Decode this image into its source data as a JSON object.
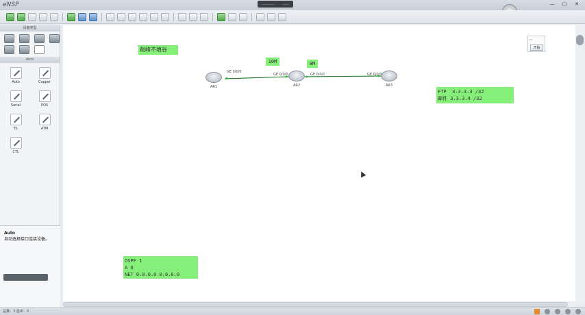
{
  "window": {
    "app_title": "eNSP",
    "title_pill": [
      "…………",
      "……"
    ],
    "buttons": [
      "—",
      "▢",
      "✕"
    ]
  },
  "left_panel": {
    "devices_header": "设备类型",
    "connections_header": "Auto",
    "connections": [
      {
        "label": "Auto"
      },
      {
        "label": "Copper"
      },
      {
        "label": "Serial"
      },
      {
        "label": "POS"
      },
      {
        "label": "E1"
      },
      {
        "label": "ATM"
      },
      {
        "label": "CTL"
      }
    ],
    "description": {
      "title": "Auto",
      "text": "自动选择接口连接设备。"
    }
  },
  "canvas": {
    "notes": {
      "split": "削峰不填谷",
      "bw1": "10M",
      "bw2": "8M",
      "ftp": "FTP  3.3.3.3 /32\n邮件 3.3.3.4 /32",
      "ospf": "OSPF 1\nA 0\nNET 0.0.0.0 0.0.0.0"
    },
    "routers": [
      {
        "name": "AR1"
      },
      {
        "name": "AR2"
      },
      {
        "name": "AR3"
      }
    ],
    "ports": [
      "GE 0/0/0",
      "GE 0/0/0",
      "GE 0/0/1",
      "GE 0/0/0"
    ],
    "start_button": "开始"
  },
  "statusbar": {
    "text": "总数：3  选中：0"
  },
  "colors": {
    "note_green": "#86ef7a",
    "link_green": "#2bbf3a"
  }
}
